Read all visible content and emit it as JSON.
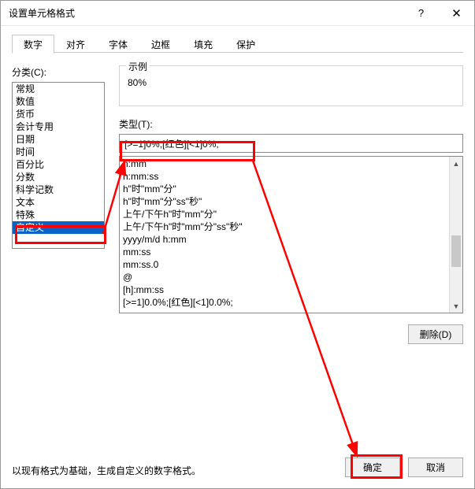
{
  "window": {
    "title": "设置单元格格式"
  },
  "tabs": [
    {
      "label": "数字",
      "active": true
    },
    {
      "label": "对齐"
    },
    {
      "label": "字体"
    },
    {
      "label": "边框"
    },
    {
      "label": "填充"
    },
    {
      "label": "保护"
    }
  ],
  "category": {
    "label": "分类(C):",
    "items": [
      "常规",
      "数值",
      "货币",
      "会计专用",
      "日期",
      "时间",
      "百分比",
      "分数",
      "科学记数",
      "文本",
      "特殊",
      "自定义"
    ],
    "selected_index": 11
  },
  "example": {
    "legend": "示例",
    "value": "80%"
  },
  "type": {
    "label": "类型(T):",
    "value": "[>=1]0%;[红色][<1]0%;",
    "formats": [
      "h:mm",
      "h:mm:ss",
      "h\"时\"mm\"分\"",
      "h\"时\"mm\"分\"ss\"秒\"",
      "上午/下午h\"时\"mm\"分\"",
      "上午/下午h\"时\"mm\"分\"ss\"秒\"",
      "yyyy/m/d h:mm",
      "mm:ss",
      "mm:ss.0",
      "@",
      "[h]:mm:ss",
      "[>=1]0.0%;[红色][<1]0.0%;"
    ]
  },
  "buttons": {
    "delete": "删除(D)",
    "ok": "确定",
    "cancel": "取消"
  },
  "help": "以现有格式为基础，生成自定义的数字格式。"
}
